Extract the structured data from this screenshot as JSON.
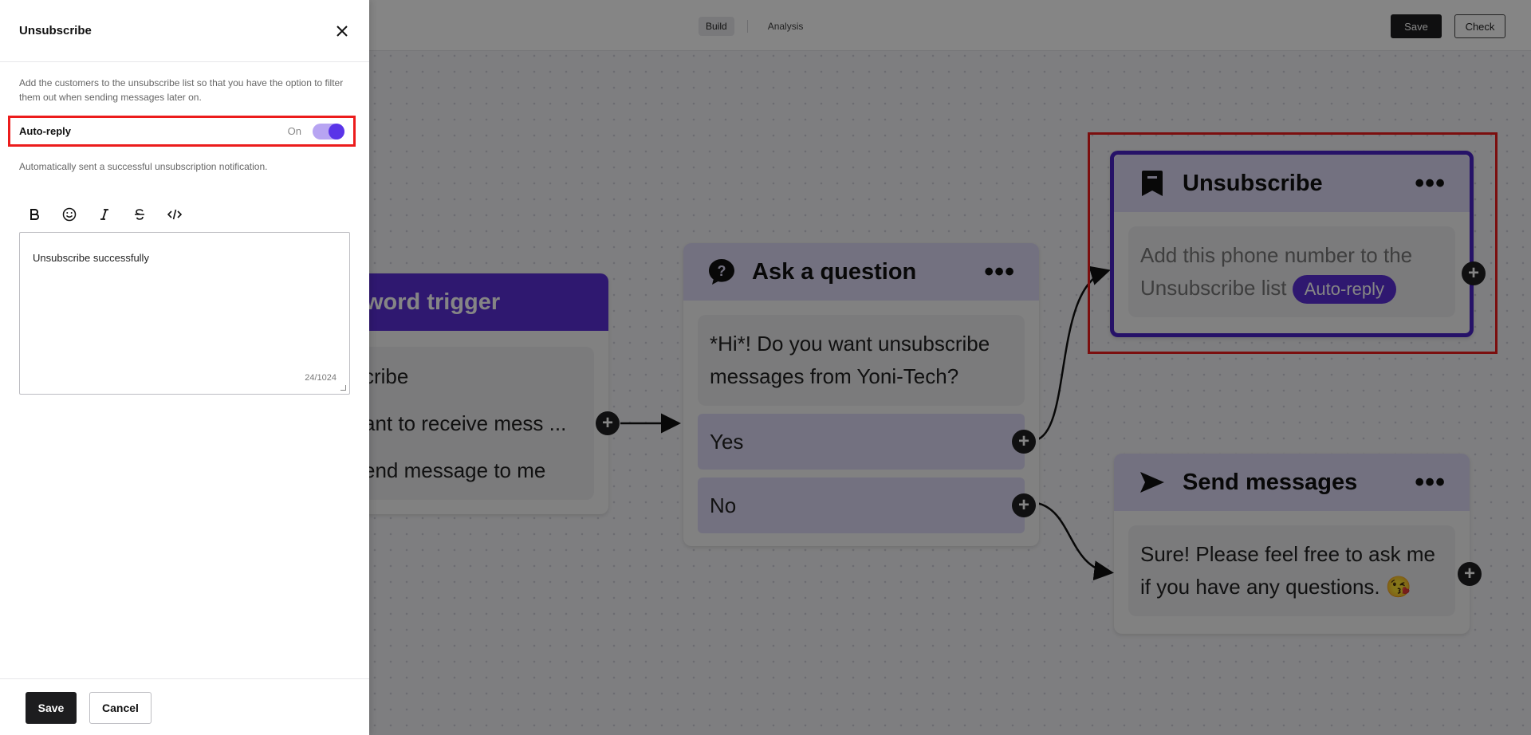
{
  "topbar": {
    "tabs": [
      {
        "label": "Build",
        "active": true
      },
      {
        "label": "Analysis",
        "active": false
      }
    ],
    "save_label": "Save",
    "check_label": "Check"
  },
  "nodes": {
    "keyword_trigger": {
      "title_visible": "word trigger",
      "chips": [
        "cribe",
        "ant to receive mess ...",
        "end message to me"
      ]
    },
    "ask_question": {
      "title": "Ask a question",
      "message": "*Hi*! Do you want unsubscribe messages from Yoni-Tech?",
      "options": [
        "Yes",
        "No"
      ]
    },
    "unsubscribe": {
      "title": "Unsubscribe",
      "message": "Add this phone number to the Unsubscribe list",
      "chip": "Auto-reply"
    },
    "send_messages": {
      "title": "Send messages",
      "message": "Sure! Please feel free to ask me if you have any questions.",
      "emoji": "😘"
    }
  },
  "panel": {
    "title": "Unsubscribe",
    "description": "Add the customers to the unsubscribe list so that you have the option to filter them out when sending messages later on.",
    "auto_reply": {
      "label": "Auto-reply",
      "state": "On",
      "enabled": true
    },
    "auto_reply_hint": "Automatically sent a successful unsubscription notification.",
    "format_tools": [
      "bold-icon",
      "emoji-icon",
      "italic-icon",
      "strikethrough-icon",
      "code-icon"
    ],
    "editor": {
      "value": "Unsubscribe successfully",
      "count": "24/1024"
    },
    "save_label": "Save",
    "cancel_label": "Cancel"
  },
  "colors": {
    "accent": "#5b2fd6",
    "node_header": "#ddd9f6",
    "highlight": "#ec1c1c",
    "dark_button": "#1d1d1f"
  }
}
